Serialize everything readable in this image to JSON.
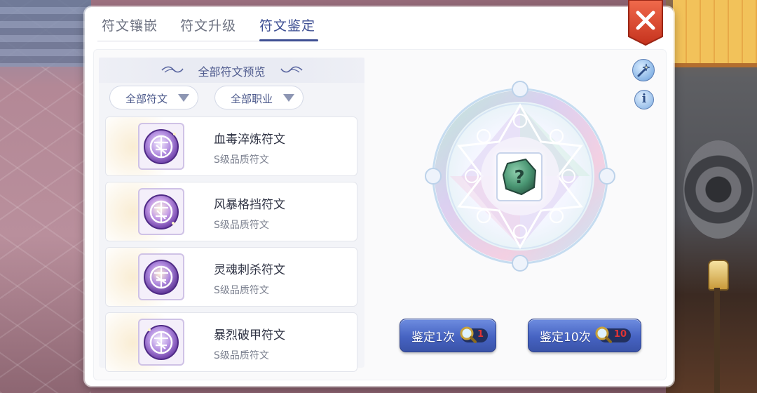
{
  "tabs": [
    {
      "label": "符文镶嵌",
      "active": false
    },
    {
      "label": "符文升级",
      "active": false
    },
    {
      "label": "符文鉴定",
      "active": true
    }
  ],
  "list": {
    "header": "全部符文预览",
    "filters": [
      {
        "label": "全部符文"
      },
      {
        "label": "全部职业"
      }
    ],
    "items": [
      {
        "name": "血毒淬炼符文",
        "grade": "S级品质符文"
      },
      {
        "name": "风暴格挡符文",
        "grade": "S级品质符文"
      },
      {
        "name": "灵魂刺杀符文",
        "grade": "S级品质符文"
      },
      {
        "name": "暴烈破甲符文",
        "grade": "S级品质符文"
      }
    ]
  },
  "identify": {
    "center_icon": "unknown-rune-stone-icon",
    "buttons": [
      {
        "label": "鉴定1次",
        "cost": "1",
        "cost_icon": "magnifier-icon"
      },
      {
        "label": "鉴定10次",
        "cost": "10",
        "cost_icon": "magnifier-icon"
      }
    ],
    "tools": {
      "wand": "magic-wand-icon",
      "info": "i"
    }
  },
  "colors": {
    "accent": "#3e4f93",
    "button": "#4663c2",
    "close": "#d9412a",
    "cost_text": "#e23434"
  }
}
